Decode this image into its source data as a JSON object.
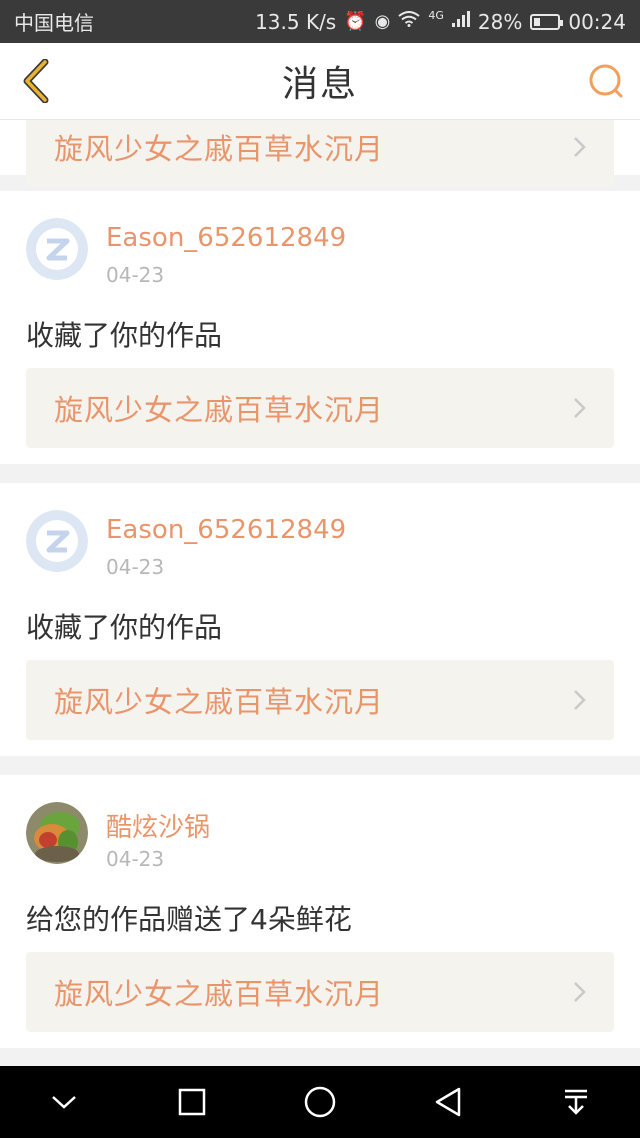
{
  "status_bar": {
    "carrier": "中国电信",
    "speed": "13.5 K/s",
    "network": "4G",
    "battery_percent": "28%",
    "battery_level": 0.28,
    "time": "00:24"
  },
  "header": {
    "title": "消息",
    "back_icon": "chevron-left-icon",
    "search_icon": "search-icon",
    "accent_color": "#e9a640"
  },
  "partial_card": {
    "work_title": "旋风少女之戚百草水沉月"
  },
  "messages": [
    {
      "user": "Eason_652612849",
      "date": "04-23",
      "action": "收藏了你的作品",
      "work_title": "旋风少女之戚百草水沉月"
    },
    {
      "user": "Eason_652612849",
      "date": "04-23",
      "action": "收藏了你的作品",
      "work_title": "旋风少女之戚百草水沉月"
    },
    {
      "user": "酷炫沙锅",
      "date": "04-23",
      "action": "给您的作品赠送了4朵鲜花",
      "work_title": "旋风少女之戚百草水沉月"
    }
  ],
  "colors": {
    "name": "#e9956b",
    "link_bg": "#f5f3ee",
    "separator": "#f2f2f2"
  },
  "system_nav": {
    "icons": [
      "chevron-down-icon",
      "square-icon",
      "circle-icon",
      "triangle-back-icon",
      "download-icon"
    ]
  }
}
